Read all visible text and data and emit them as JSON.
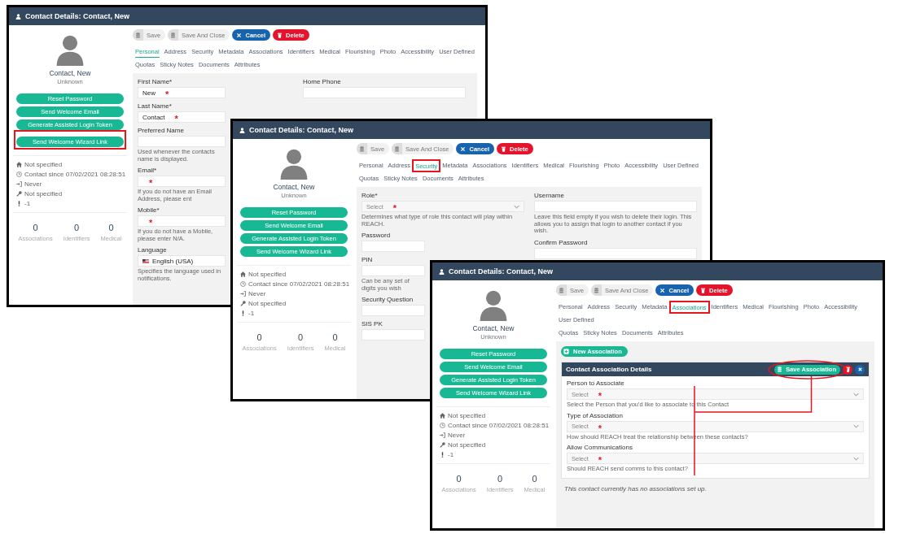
{
  "windows": [
    {
      "title": "Contact Details: Contact, New",
      "toolbar": [
        {
          "label": "Save",
          "kind": "save"
        },
        {
          "label": "Save And Close",
          "kind": "save"
        },
        {
          "label": "Cancel",
          "kind": "cancel"
        },
        {
          "label": "Delete",
          "kind": "delete"
        }
      ],
      "profile": {
        "name": "Contact, New",
        "status": "Unknown"
      },
      "actions": [
        {
          "label": "Reset Password",
          "highlighted": false
        },
        {
          "label": "Send Welcome Email",
          "highlighted": false
        },
        {
          "label": "Generate Assisted Login Token",
          "highlighted": false
        },
        {
          "label": "Send Welcome Wizard Link",
          "highlighted": true
        }
      ],
      "info": [
        {
          "kind": "home",
          "text": "Not specified"
        },
        {
          "kind": "clock",
          "text": "Contact since 07/02/2021 08:28:51"
        },
        {
          "kind": "login",
          "text": "Never"
        },
        {
          "kind": "key",
          "text": "Not specified"
        },
        {
          "kind": "alert",
          "text": "-1"
        }
      ],
      "stats": [
        {
          "value": "0",
          "label": "Associations"
        },
        {
          "value": "0",
          "label": "Identifiers"
        },
        {
          "value": "0",
          "label": "Medical"
        }
      ],
      "tab_rows": [
        [
          {
            "label": "Personal",
            "selected": true,
            "highlighted": false
          },
          {
            "label": "Address",
            "selected": false,
            "highlighted": false
          },
          {
            "label": "Security",
            "selected": false,
            "highlighted": false
          },
          {
            "label": "Metadata",
            "selected": false,
            "highlighted": false
          },
          {
            "label": "Associations",
            "selected": false,
            "highlighted": false
          },
          {
            "label": "Identifiers",
            "selected": false,
            "highlighted": false
          },
          {
            "label": "Medical",
            "selected": false,
            "highlighted": false
          },
          {
            "label": "Flourishing",
            "selected": false,
            "highlighted": false
          },
          {
            "label": "Photo",
            "selected": false,
            "highlighted": false
          },
          {
            "label": "Accessibility",
            "selected": false,
            "highlighted": false
          },
          {
            "label": "User Defined",
            "selected": false,
            "highlighted": false
          }
        ],
        [
          {
            "label": "Quotas",
            "selected": false,
            "highlighted": false
          },
          {
            "label": "Sticky Notes",
            "selected": false,
            "highlighted": false
          },
          {
            "label": "Documents",
            "selected": false,
            "highlighted": false
          },
          {
            "label": "Attributes",
            "selected": false,
            "highlighted": false
          }
        ]
      ],
      "form": {
        "kind": "fields",
        "columns": [
          [
            {
              "label": "First Name*",
              "kind": "text",
              "value": "New",
              "mark": "*"
            },
            {
              "label": "Last Name*",
              "kind": "text",
              "value": "Contact",
              "mark": "*"
            },
            {
              "label": "Preferred Name",
              "kind": "text",
              "hint": "Used whenever the contacts name is displayed."
            },
            {
              "label": "Email*",
              "kind": "text",
              "mark": "*",
              "hint": "If you do not have an Email Address, please ent"
            },
            {
              "label": "Mobile*",
              "kind": "text",
              "mark": "*",
              "hint": "If you do not have a Mobile, please enter N/A."
            },
            {
              "label": "Language",
              "kind": "language",
              "value": "English (USA)",
              "hint": "Specifies the language used in notifications."
            }
          ],
          [
            {
              "label": "Home Phone",
              "kind": "text"
            }
          ]
        ]
      }
    },
    {
      "title": "Contact Details: Contact, New",
      "toolbar": [
        {
          "label": "Save",
          "kind": "save"
        },
        {
          "label": "Save And Close",
          "kind": "save"
        },
        {
          "label": "Cancel",
          "kind": "cancel"
        },
        {
          "label": "Delete",
          "kind": "delete"
        }
      ],
      "profile": {
        "name": "Contact, New",
        "status": "Unknown"
      },
      "actions": [
        {
          "label": "Reset Password",
          "highlighted": false
        },
        {
          "label": "Send Welcome Email",
          "highlighted": false
        },
        {
          "label": "Generate Assisted Login Token",
          "highlighted": false
        },
        {
          "label": "Send Welcome Wizard Link",
          "highlighted": false
        }
      ],
      "info": [
        {
          "kind": "home",
          "text": "Not specified"
        },
        {
          "kind": "clock",
          "text": "Contact since 07/02/2021 08:28:51"
        },
        {
          "kind": "login",
          "text": "Never"
        },
        {
          "kind": "key",
          "text": "Not specified"
        },
        {
          "kind": "alert",
          "text": "-1"
        }
      ],
      "stats": [
        {
          "value": "0",
          "label": "Associations"
        },
        {
          "value": "0",
          "label": "Identifiers"
        },
        {
          "value": "0",
          "label": "Medical"
        }
      ],
      "tab_rows": [
        [
          {
            "label": "Personal",
            "selected": false,
            "highlighted": false
          },
          {
            "label": "Address",
            "selected": false,
            "highlighted": false
          },
          {
            "label": "Security",
            "selected": true,
            "highlighted": true
          },
          {
            "label": "Metadata",
            "selected": false,
            "highlighted": false
          },
          {
            "label": "Associations",
            "selected": false,
            "highlighted": false
          },
          {
            "label": "Identifiers",
            "selected": false,
            "highlighted": false
          },
          {
            "label": "Medical",
            "selected": false,
            "highlighted": false
          },
          {
            "label": "Flourishing",
            "selected": false,
            "highlighted": false
          },
          {
            "label": "Photo",
            "selected": false,
            "highlighted": false
          },
          {
            "label": "Accessibility",
            "selected": false,
            "highlighted": false
          },
          {
            "label": "User Defined",
            "selected": false,
            "highlighted": false
          }
        ],
        [
          {
            "label": "Quotas",
            "selected": false,
            "highlighted": false
          },
          {
            "label": "Sticky Notes",
            "selected": false,
            "highlighted": false
          },
          {
            "label": "Documents",
            "selected": false,
            "highlighted": false
          },
          {
            "label": "Attributes",
            "selected": false,
            "highlighted": false
          }
        ]
      ],
      "form": {
        "kind": "fields",
        "columns": [
          [
            {
              "label": "Role*",
              "kind": "select",
              "placeholder": "Select",
              "mark": "*",
              "hint": "Determines what type of role this contact will play within REACH."
            },
            {
              "label": "Password",
              "kind": "text"
            },
            {
              "label": "PIN",
              "kind": "text",
              "hint": "Can be any set of digits you wish"
            },
            {
              "label": "Security Question",
              "kind": "text"
            },
            {
              "label": "SIS PK",
              "kind": "text"
            }
          ],
          [
            {
              "label": "Username",
              "kind": "text",
              "hint": "Leave this field empty if you wish to delete their login. This allows you to assign that login to another contact if you wish."
            },
            {
              "label": "Confirm Password",
              "kind": "text"
            }
          ]
        ]
      }
    },
    {
      "title": "Contact Details: Contact, New",
      "toolbar": [
        {
          "label": "Save",
          "kind": "save"
        },
        {
          "label": "Save And Close",
          "kind": "save"
        },
        {
          "label": "Cancel",
          "kind": "cancel"
        },
        {
          "label": "Delete",
          "kind": "delete"
        }
      ],
      "profile": {
        "name": "Contact, New",
        "status": "Unknown"
      },
      "actions": [
        {
          "label": "Reset Password",
          "highlighted": false
        },
        {
          "label": "Send Welcome Email",
          "highlighted": false
        },
        {
          "label": "Generate Assisted Login Token",
          "highlighted": false
        },
        {
          "label": "Send Welcome Wizard Link",
          "highlighted": false
        }
      ],
      "info": [
        {
          "kind": "home",
          "text": "Not specified"
        },
        {
          "kind": "clock",
          "text": "Contact since 07/02/2021 08:28:51"
        },
        {
          "kind": "login",
          "text": "Never"
        },
        {
          "kind": "key",
          "text": "Not specified"
        },
        {
          "kind": "alert",
          "text": "-1"
        }
      ],
      "stats": [
        {
          "value": "0",
          "label": "Associations"
        },
        {
          "value": "0",
          "label": "Identifiers"
        },
        {
          "value": "0",
          "label": "Medical"
        }
      ],
      "tab_rows": [
        [
          {
            "label": "Personal",
            "selected": false,
            "highlighted": false
          },
          {
            "label": "Address",
            "selected": false,
            "highlighted": false
          },
          {
            "label": "Security",
            "selected": false,
            "highlighted": false
          },
          {
            "label": "Metadata",
            "selected": false,
            "highlighted": false
          },
          {
            "label": "Associations",
            "selected": true,
            "highlighted": true
          },
          {
            "label": "Identifiers",
            "selected": false,
            "highlighted": false
          },
          {
            "label": "Medical",
            "selected": false,
            "highlighted": false
          },
          {
            "label": "Flourishing",
            "selected": false,
            "highlighted": false
          },
          {
            "label": "Photo",
            "selected": false,
            "highlighted": false
          },
          {
            "label": "Accessibility",
            "selected": false,
            "highlighted": false
          },
          {
            "label": "User Defined",
            "selected": false,
            "highlighted": false
          }
        ],
        [
          {
            "label": "Quotas",
            "selected": false,
            "highlighted": false
          },
          {
            "label": "Sticky Notes",
            "selected": false,
            "highlighted": false
          },
          {
            "label": "Documents",
            "selected": false,
            "highlighted": false
          },
          {
            "label": "Attributes",
            "selected": false,
            "highlighted": false
          }
        ]
      ],
      "form": {
        "kind": "associations",
        "new_button": "New Association",
        "card": {
          "title": "Contact Association Details",
          "save_button": {
            "label": "Save Association",
            "circled": true
          },
          "fields": [
            {
              "label": "Person to Associate",
              "kind": "select",
              "placeholder": "Select",
              "mark": "*",
              "hint": "Select the Person that you'd like to associate to this Contact"
            },
            {
              "label": "Type of Association",
              "kind": "select",
              "placeholder": "Select",
              "mark": "*",
              "hint": "How should REACH treat the relationship between these contacts?"
            },
            {
              "label": "Allow Communications",
              "kind": "select",
              "placeholder": "Select",
              "mark": "*",
              "hint": "Should REACH send comms to this contact?"
            }
          ]
        },
        "note": "This contact currently has no associations set up."
      }
    }
  ]
}
